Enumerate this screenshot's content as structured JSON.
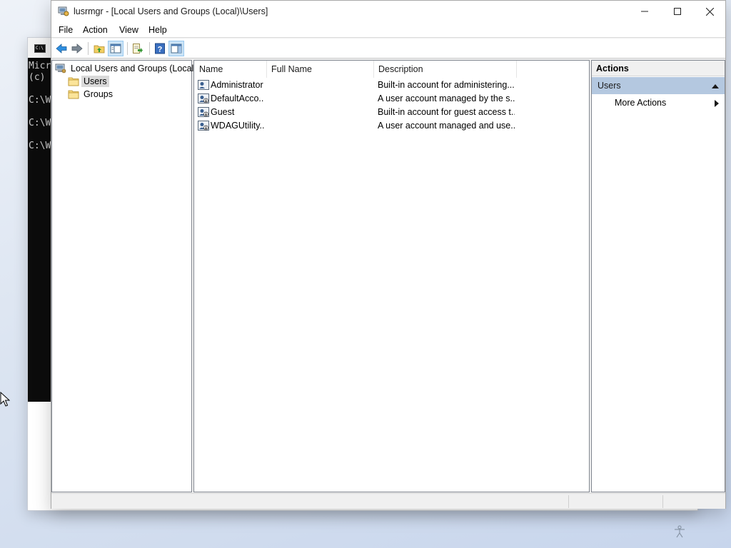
{
  "console": {
    "lines": [
      "Micr",
      "(c)",
      "C:\\W",
      "C:\\W",
      "C:\\W"
    ]
  },
  "window": {
    "title": "lusrmgr - [Local Users and Groups (Local)\\Users]",
    "controls": {
      "minimize": "minimize-icon",
      "maximize": "maximize-icon",
      "close": "close-icon"
    }
  },
  "menu": [
    "File",
    "Action",
    "View",
    "Help"
  ],
  "toolbar": {
    "buttons": [
      "back-arrow-icon",
      "forward-arrow-icon",
      "up-folder-icon",
      "show-hide-console-tree-icon",
      "export-list-icon",
      "help-icon",
      "show-hide-action-pane-icon"
    ]
  },
  "tree": {
    "root": "Local Users and Groups (Local)",
    "children": [
      "Users",
      "Groups"
    ],
    "selected": "Users"
  },
  "list": {
    "columns": [
      "Name",
      "Full Name",
      "Description"
    ],
    "rows": [
      {
        "name": "Administrator",
        "full_name": "",
        "description": "Built-in account for administering..."
      },
      {
        "name": "DefaultAcco...",
        "full_name": "",
        "description": "A user account managed by the s..."
      },
      {
        "name": "Guest",
        "full_name": "",
        "description": "Built-in account for guest access t..."
      },
      {
        "name": "WDAGUtility...",
        "full_name": "",
        "description": "A user account managed and use..."
      }
    ]
  },
  "actions": {
    "title": "Actions",
    "section": "Users",
    "items": [
      "More Actions"
    ]
  },
  "colors": {
    "selection": "#d9d9d9",
    "actions_section": "#b4c8e0",
    "toolbar_active": "#cce4f7",
    "console_bg": "#0c0c0c"
  }
}
